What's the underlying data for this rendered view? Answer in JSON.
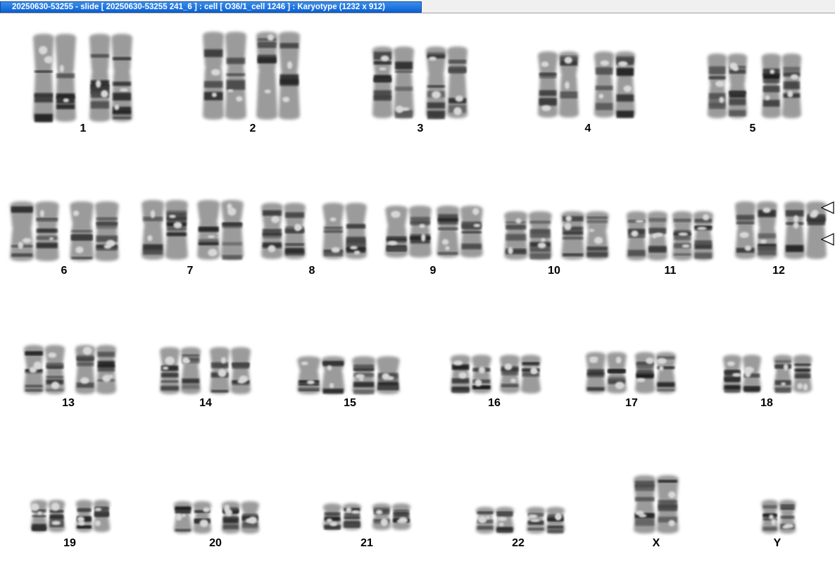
{
  "window": {
    "title": "20250630-53255 - slide [ 20250630-53255 241_6 ] : cell [ O36/1_cell 1246 ] : Karyotype  (1232 x 912)"
  },
  "karyotype": {
    "chromosomes": [
      {
        "id": "1",
        "label": "1"
      },
      {
        "id": "2",
        "label": "2"
      },
      {
        "id": "3",
        "label": "3"
      },
      {
        "id": "4",
        "label": "4"
      },
      {
        "id": "5",
        "label": "5"
      },
      {
        "id": "6",
        "label": "6"
      },
      {
        "id": "7",
        "label": "7"
      },
      {
        "id": "8",
        "label": "8"
      },
      {
        "id": "9",
        "label": "9"
      },
      {
        "id": "10",
        "label": "10"
      },
      {
        "id": "11",
        "label": "11"
      },
      {
        "id": "12",
        "label": "12"
      },
      {
        "id": "13",
        "label": "13"
      },
      {
        "id": "14",
        "label": "14"
      },
      {
        "id": "15",
        "label": "15"
      },
      {
        "id": "16",
        "label": "16"
      },
      {
        "id": "17",
        "label": "17"
      },
      {
        "id": "18",
        "label": "18"
      },
      {
        "id": "19",
        "label": "19"
      },
      {
        "id": "20",
        "label": "20"
      },
      {
        "id": "21",
        "label": "21"
      },
      {
        "id": "22",
        "label": "22"
      },
      {
        "id": "X",
        "label": "X"
      },
      {
        "id": "Y",
        "label": "Y"
      }
    ],
    "markers": [
      {
        "name": "arrow-marker-icon",
        "chromosome": "12"
      },
      {
        "name": "arrow-marker-icon",
        "chromosome": "12"
      }
    ]
  }
}
